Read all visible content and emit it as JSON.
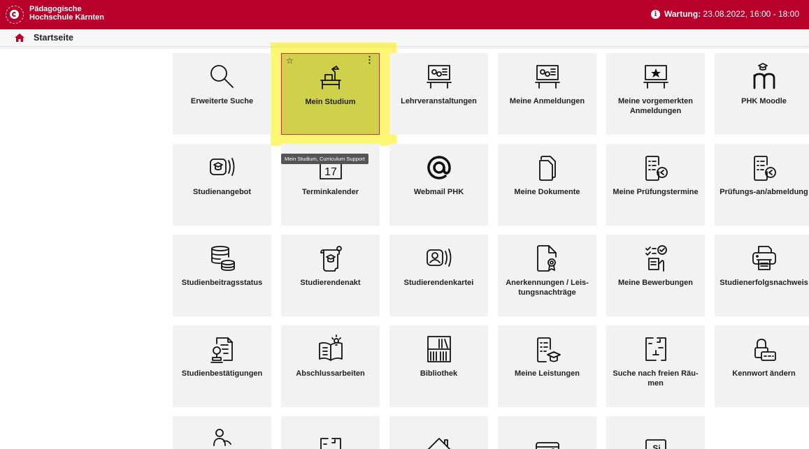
{
  "header": {
    "logo_line1": "Pädagogische",
    "logo_line2": "Hochschule Kärnten",
    "maintenance_label": "Wartung:",
    "maintenance_text": " 23.08.2022, 16:00 - 18:00",
    "background_color": "#b8002b"
  },
  "breadcrumb": {
    "home_icon": "home-icon",
    "label": "Startseite"
  },
  "active_tile": {
    "star_icon": "star-outline-icon",
    "menu_icon": "kebab-menu-icon",
    "tooltip": "Mein Studium, Curriculum Support",
    "highlight_color": "#fff000"
  },
  "tiles": [
    {
      "label": "Erweiterte Suche",
      "icon": "search-icon"
    },
    {
      "label": "Mein Studium",
      "icon": "desk-lamp-icon"
    },
    {
      "label": "Lehrveranstaltungen",
      "icon": "lecture-board-icon"
    },
    {
      "label": "Meine Anmeldungen",
      "icon": "registration-board-icon"
    },
    {
      "label": "Meine vorgemerkten Anmeldungen",
      "icon": "starred-board-icon"
    },
    {
      "label": "PHK Moodle",
      "icon": "moodle-icon"
    },
    {
      "label": "Studienangebot",
      "icon": "study-offer-icon"
    },
    {
      "label": "Terminkalender",
      "icon": "calendar-icon",
      "calendar_day": "17"
    },
    {
      "label": "Webmail PHK",
      "icon": "at-sign-icon"
    },
    {
      "label": "Meine Dokumente",
      "icon": "documents-icon"
    },
    {
      "label": "Meine Prüfungstermine",
      "icon": "exam-dates-icon"
    },
    {
      "label": "Prüfungs-an/abmeldung",
      "icon": "exam-registration-icon"
    },
    {
      "label": "Studienbeitragsstatus",
      "icon": "coins-icon"
    },
    {
      "label": "Studierendenakt",
      "icon": "student-file-icon"
    },
    {
      "label": "Studierendenkartei",
      "icon": "student-card-icon"
    },
    {
      "label": "Anerkennungen / Leis-tungsnachträge",
      "icon": "certificate-document-icon"
    },
    {
      "label": "Meine Bewerbungen",
      "icon": "applications-icon"
    },
    {
      "label": "Studienerfolgsnachweis",
      "icon": "printer-icon"
    },
    {
      "label": "Studienbestätigungen",
      "icon": "confirmation-icon"
    },
    {
      "label": "Abschlussarbeiten",
      "icon": "thesis-book-icon"
    },
    {
      "label": "Bibliothek",
      "icon": "library-icon"
    },
    {
      "label": "Meine Leistungen",
      "icon": "achievements-icon"
    },
    {
      "label": "Suche nach freien Räu-men",
      "icon": "room-search-icon"
    },
    {
      "label": "Kennwort ändern",
      "icon": "lock-password-icon"
    },
    {
      "label": "",
      "icon": "person-group-icon"
    },
    {
      "label": "",
      "icon": "room-icon"
    },
    {
      "label": "",
      "icon": "house-icon"
    },
    {
      "label": "",
      "icon": "web-card-icon"
    },
    {
      "label": "",
      "icon": "si-icon",
      "icon_text": "Si"
    }
  ]
}
